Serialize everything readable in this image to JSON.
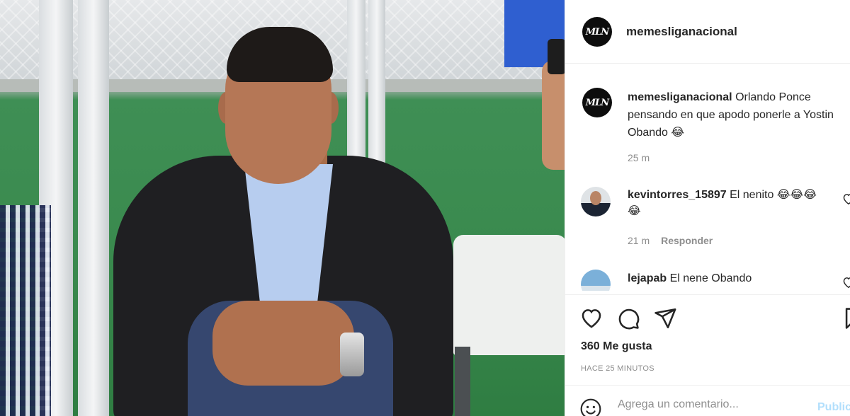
{
  "post": {
    "username": "memesliganacional",
    "avatar_text": "MLN"
  },
  "caption": {
    "username": "memesliganacional",
    "text": "Orlando Ponce pensando en que apodo ponerle a Yostin Obando 😂",
    "time": "25 m"
  },
  "comments": [
    {
      "username": "kevintorres_15897",
      "text": "El nenito 😂😂😂😂",
      "time": "21 m",
      "reply_label": "Responder"
    },
    {
      "username": "lejapab",
      "text": "El nene Obando"
    }
  ],
  "actions": {
    "like_icon": "heart-icon",
    "comment_icon": "comment-icon",
    "share_icon": "paper-plane-icon",
    "save_icon": "bookmark-icon"
  },
  "likes": "360 Me gusta",
  "posted_ago": "HACE 25 MINUTOS",
  "add_comment": {
    "placeholder": "Agrega un comentario...",
    "publish_label": "Publicar",
    "emoji_icon": "smiley-icon"
  },
  "colors": {
    "text": "#262626",
    "muted": "#8e8e8e",
    "publish_disabled": "#b2dffc",
    "divider": "#efefef"
  }
}
